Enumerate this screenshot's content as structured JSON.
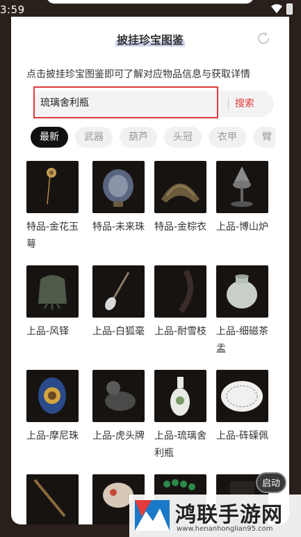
{
  "status_bar": {
    "time": "3:59"
  },
  "header": {
    "title": "披挂珍宝图鉴"
  },
  "intro": "点击披挂珍宝图鉴即可了解对应物品信息与获取详情",
  "search": {
    "value": "琉璃舍利瓶",
    "button_label": "搜索"
  },
  "tabs": [
    "最新",
    "武器",
    "葫芦",
    "头冠",
    "衣甲",
    "臂"
  ],
  "items": [
    {
      "label": "特品-金花玉萼",
      "icon": "gold-hairpin"
    },
    {
      "label": "特品-未来珠",
      "icon": "ornate-orb"
    },
    {
      "label": "特品-金棕衣",
      "icon": "feather-cloak"
    },
    {
      "label": "上品-博山炉",
      "icon": "incense-burner"
    },
    {
      "label": "上品-风铎",
      "icon": "bronze-bell"
    },
    {
      "label": "上品-白狐毫",
      "icon": "brush"
    },
    {
      "label": "上品-耐雪枝",
      "icon": "curved-branch"
    },
    {
      "label": "上品-细磁茶盂",
      "icon": "celadon-jar"
    },
    {
      "label": "上品-摩尼珠",
      "icon": "jewel-ring"
    },
    {
      "label": "上品-虎头牌",
      "icon": "tiger-figure"
    },
    {
      "label": "上品-琉璃舍利瓶",
      "icon": "porcelain-vase"
    },
    {
      "label": "上品-砗磲佩",
      "icon": "white-disc"
    },
    {
      "label": "",
      "icon": "staff"
    },
    {
      "label": "",
      "icon": "jade-carving"
    },
    {
      "label": "",
      "icon": "green-beads"
    },
    {
      "label": "",
      "icon": "dark-item"
    }
  ],
  "float_button": "启动",
  "watermark": {
    "title": "鸿联手游网",
    "url": "www.henanhonglian95.com"
  }
}
